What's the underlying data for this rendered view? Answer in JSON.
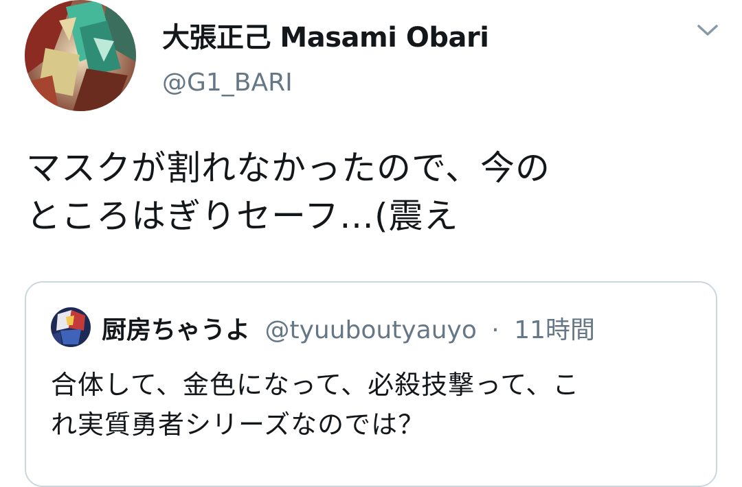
{
  "tweet": {
    "author": {
      "display_name": "大張正己 Masami Obari",
      "handle": "@G1_BARI",
      "avatar_icon": "robot-avatar-icon"
    },
    "menu_icon": "chevron-down-icon",
    "text_lines": [
      "マスクが割れなかったので、今の",
      "ところはぎりセーフ…(震え"
    ]
  },
  "quoted_tweet": {
    "author": {
      "display_name": "厨房ちゃうよ",
      "handle": "@tyuuboutyauyo",
      "separator": "·",
      "time": "11時間",
      "avatar_icon": "robot-avatar-icon"
    },
    "text_lines": [
      "合体して、金色になって、必殺技撃って、こ",
      "れ実質勇者シリーズなのでは？"
    ]
  },
  "colors": {
    "primary_text": "#14171a",
    "secondary_text": "#657786",
    "border": "#ccd6dd"
  }
}
